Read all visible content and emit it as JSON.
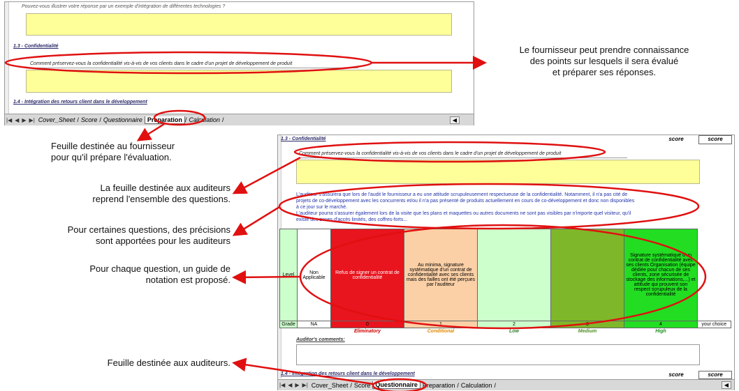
{
  "top_sheet": {
    "intro_text": "Pouvez-vous illustrer votre réponse par un exemple d'intégration de différentes technologies ?",
    "section_13": "1.3 - Confidentialité",
    "question": "Comment préservez-vous la confidentialité vis-à-vis de vos clients dans le cadre d'un projet de développement de produit",
    "section_14": "1.4 - Intégration des retours client dans le développement",
    "tabs": [
      "Cover_Sheet",
      "Score",
      "Questionnaire",
      "Preparation",
      "Calculation"
    ],
    "active_tab": "Preparation"
  },
  "bottom_sheet": {
    "section_13": "1.3 - Confidentialité",
    "score_label": "score",
    "score_value": "score",
    "question": "Comment préservez-vous la confidentialité vis-à-vis de vos clients dans le cadre d'un projet de développement de produit",
    "auditor_note": [
      "L'auditeur s'assurera que lors de l'audit le fournisseur a eu une attitude scrupuleusement respectueuse de la confidentialité. Notamment, il n'a pas cité de",
      "projets de co-développement avec les concurrents et/ou il n'a pas présenté de produits actuellement en cours de co-développement et donc non disponibles",
      "à ce jour sur le marché.",
      "L'auditeur pourra s'assurer également lors de la visite que les plans et maquettes ou autres documents ne sont pas visibles par n'importe quel visiteur, qu'il",
      "existe des zones d'accès limités, des coffres-forts..."
    ],
    "level_label": "Level",
    "grade_label": "Grade",
    "levels": [
      {
        "text": "Non Applicable",
        "grade": "NA",
        "label": "",
        "color": "#ffffff",
        "label_color": "#000000"
      },
      {
        "text": "Refus de signer un contrat de confidentialité",
        "grade": "0",
        "label": "Eliminatory",
        "color": "#e8141e",
        "label_color": "#cc0000"
      },
      {
        "text": "Au minima, signature systématique d'un contrat de confidentialité avec ses clients mais des failles ont été perçues par l'auditeur",
        "grade": "1",
        "label": "Conditional",
        "color": "#fbd0a6",
        "label_color": "#e08a00"
      },
      {
        "text": "",
        "grade": "2",
        "label": "Low",
        "color": "#ccffcc",
        "label_color": "#2f7f2f"
      },
      {
        "text": "",
        "grade": "3",
        "label": "Medium",
        "color": "#7fb72a",
        "label_color": "#4f8f1f"
      },
      {
        "text": "Signature systématique d'un contrat de confidentialité avec ses clients Organisation (équipe dédiée pour chacun de ses clients, zone sécurisée de stockage des informations,...) et attitude qui prouvent son respect scrupuleux de la confidentialité",
        "grade": "4",
        "label": "High",
        "color": "#22dd22",
        "label_color": "#1f8f1f"
      }
    ],
    "your_choice": "your choice",
    "auditor_comments": "Auditor's comments:",
    "section_14": "1.4 - Intégration des retours client dans le développement",
    "tabs": [
      "Cover_Sheet",
      "Score",
      "Questionnaire",
      "Preparation",
      "Calculation"
    ],
    "active_tab": "Questionnaire"
  },
  "annotations": {
    "top_right": [
      "Le fournisseur peut prendre connaissance",
      "des points sur lesquels il sera évalué",
      "et préparer ses réponses."
    ],
    "prep_sheet": [
      "Feuille destinée au fournisseur",
      "pour qu'il prépare l'évaluation."
    ],
    "auditor_sheet": [
      "La feuille destinée aux auditeurs",
      "reprend l'ensemble des questions."
    ],
    "precisions": [
      "Pour certaines questions, des précisions",
      "sont apportées pour les auditeurs"
    ],
    "guide": [
      "Pour chaque question, un guide de",
      "notation est proposé."
    ],
    "auditor_sheet_short": "Feuille destinée aux auditeurs."
  },
  "colors": {
    "annotation_red": "#e01010",
    "note_blue": "#2233aa",
    "yellow_box": "#ffff99"
  }
}
